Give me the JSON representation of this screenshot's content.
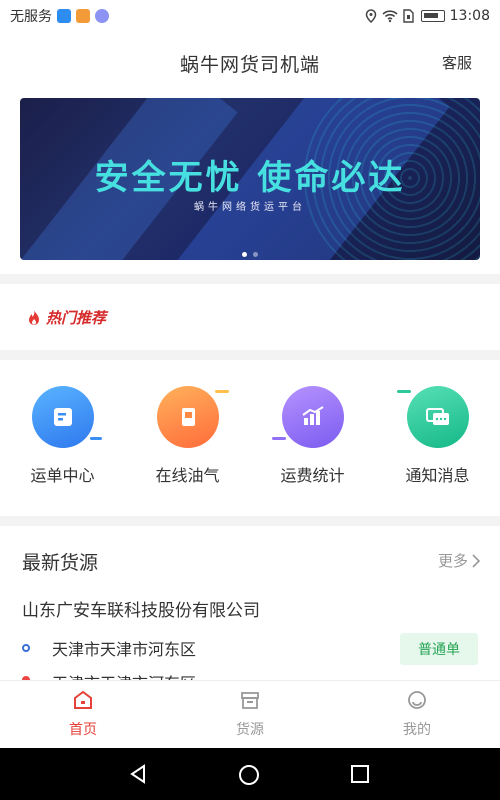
{
  "status_bar": {
    "carrier": "无服务",
    "time": "13:08",
    "icons": [
      "app-blue-icon",
      "app-orange-icon",
      "app-purple-icon",
      "location-icon",
      "wifi-icon",
      "sim-icon",
      "battery-icon"
    ]
  },
  "header": {
    "title": "蜗牛网货司机端",
    "service_label": "客服"
  },
  "banner": {
    "title": "安全无忧 使命必达",
    "subtitle": "蜗牛网络货运平台",
    "slide_count": 2,
    "active_slide": 1
  },
  "hot": {
    "label": "热门推荐",
    "icon": "flame-icon"
  },
  "quick_actions": [
    {
      "label": "运单中心",
      "icon": "waybill-icon",
      "color": "#3a8ff5"
    },
    {
      "label": "在线油气",
      "icon": "fuel-icon",
      "color": "#ff8a45"
    },
    {
      "label": "运费统计",
      "icon": "chart-icon",
      "color": "#9270f5"
    },
    {
      "label": "通知消息",
      "icon": "message-icon",
      "color": "#2cc99a"
    }
  ],
  "latest": {
    "title": "最新货源",
    "more_label": "更多",
    "item": {
      "company": "山东广安车联科技股份有限公司",
      "from": "天津市天津市河东区",
      "to": "天津市天津市河东区",
      "tag": "普通单"
    }
  },
  "bottom_nav": [
    {
      "label": "首页",
      "icon": "home-icon",
      "active": true
    },
    {
      "label": "货源",
      "icon": "cargo-box-icon",
      "active": false
    },
    {
      "label": "我的",
      "icon": "profile-icon",
      "active": false
    }
  ],
  "colors": {
    "accent": "#e5423a",
    "banner_text": "#47e0e0",
    "tag_green": "#27a555"
  }
}
